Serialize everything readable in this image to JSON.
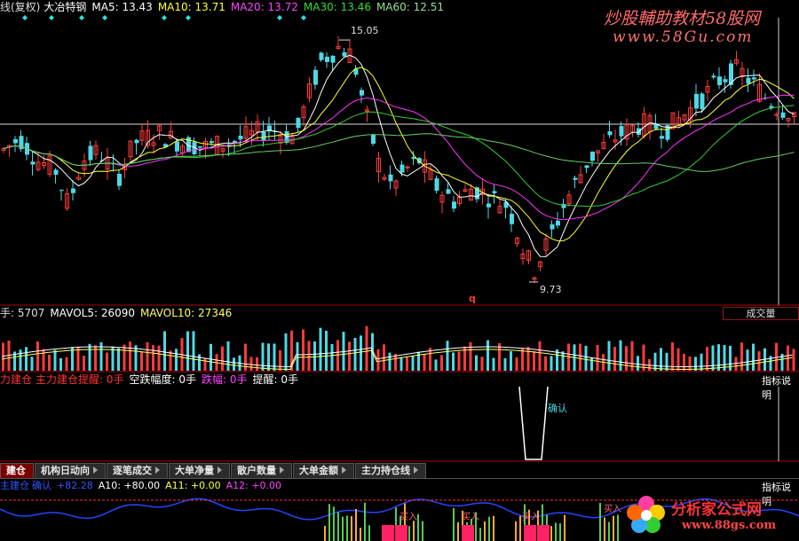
{
  "price_legend": {
    "title": "线(复权)",
    "stock": "大冶特钢",
    "ma5": "MA5: 13.43",
    "ma10": "MA10: 13.71",
    "ma20": "MA20: 13.72",
    "ma30": "MA30: 13.46",
    "ma60": "MA60: 12.51"
  },
  "markers": {
    "high": "15.05",
    "low": "9.73",
    "q": "q"
  },
  "watermark_top": {
    "line1": "炒股輔助教材58股网",
    "line2": "www.58Gu.com"
  },
  "volume_legend": {
    "vol": "手: 5707",
    "mavol5": "MAVOL5: 26090",
    "mavol10": "MAVOL10: 27346",
    "selector": "成交量"
  },
  "indicator_legend": {
    "a": "力建仓",
    "b": "主力建仓提醒: 0手",
    "c": "空跌幅度: 0手",
    "d": "跌幅: 0手",
    "e": "提醒: 0手",
    "help": "指标说明",
    "confirm": "确认"
  },
  "tabs": [
    "建仓",
    "机构日动向",
    "逐笔成交",
    "大单净量",
    "散户数量",
    "大单金额",
    "主力持仓线"
  ],
  "bottom_legend": {
    "a": "主建仓",
    "b": "确认",
    "c": "+82.28",
    "a10": "A10: +80.00",
    "a11": "A11: +0.00",
    "a12": "A12: +0.00",
    "help": "指标说明"
  },
  "bottom_marks": {
    "buy1": "买入",
    "buy2": "买入",
    "buy3": "买入",
    "buy4": "买入"
  },
  "watermark_bottom": {
    "line1": "分析家公式网",
    "line2": "www.88gs.com"
  },
  "colors": {
    "up": "#ff3b3b",
    "down": "#4dd9e6",
    "ma5": "#ffffff",
    "ma10": "#ffff33",
    "ma20": "#ff33ff",
    "ma30": "#33cc33",
    "ma60": "#66cc66",
    "axis": "#aa0000"
  },
  "chart_data": {
    "type": "candlestick",
    "title": "大冶特钢",
    "high_label": 15.05,
    "low_label": 9.73,
    "ma": {
      "MA5": 13.43,
      "MA10": 13.71,
      "MA20": 13.72,
      "MA30": 13.46,
      "MA60": 12.51
    },
    "volume": {
      "last": 5707,
      "MAVOL5": 26090,
      "MAVOL10": 27346
    }
  }
}
